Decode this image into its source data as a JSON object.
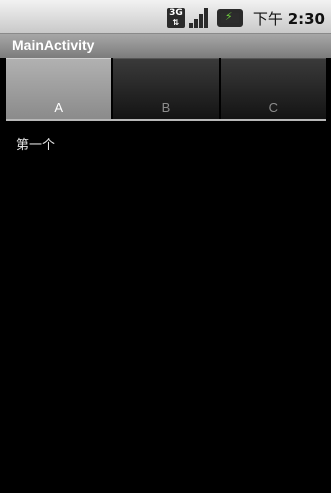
{
  "status_bar": {
    "network": "3G",
    "time_prefix": "下午",
    "time": "2:30",
    "icons": [
      "3g-icon",
      "signal-icon",
      "battery-charging-icon"
    ]
  },
  "app": {
    "title": "MainActivity"
  },
  "tabs": [
    {
      "label": "A",
      "selected": true
    },
    {
      "label": "B",
      "selected": false
    },
    {
      "label": "C",
      "selected": false
    }
  ],
  "content": {
    "text": "第一个"
  },
  "colors": {
    "background": "#000000",
    "tab_active": "#9e9e9e",
    "tab_inactive": "#1f1f1f",
    "battery_bolt": "#6fd13c"
  }
}
